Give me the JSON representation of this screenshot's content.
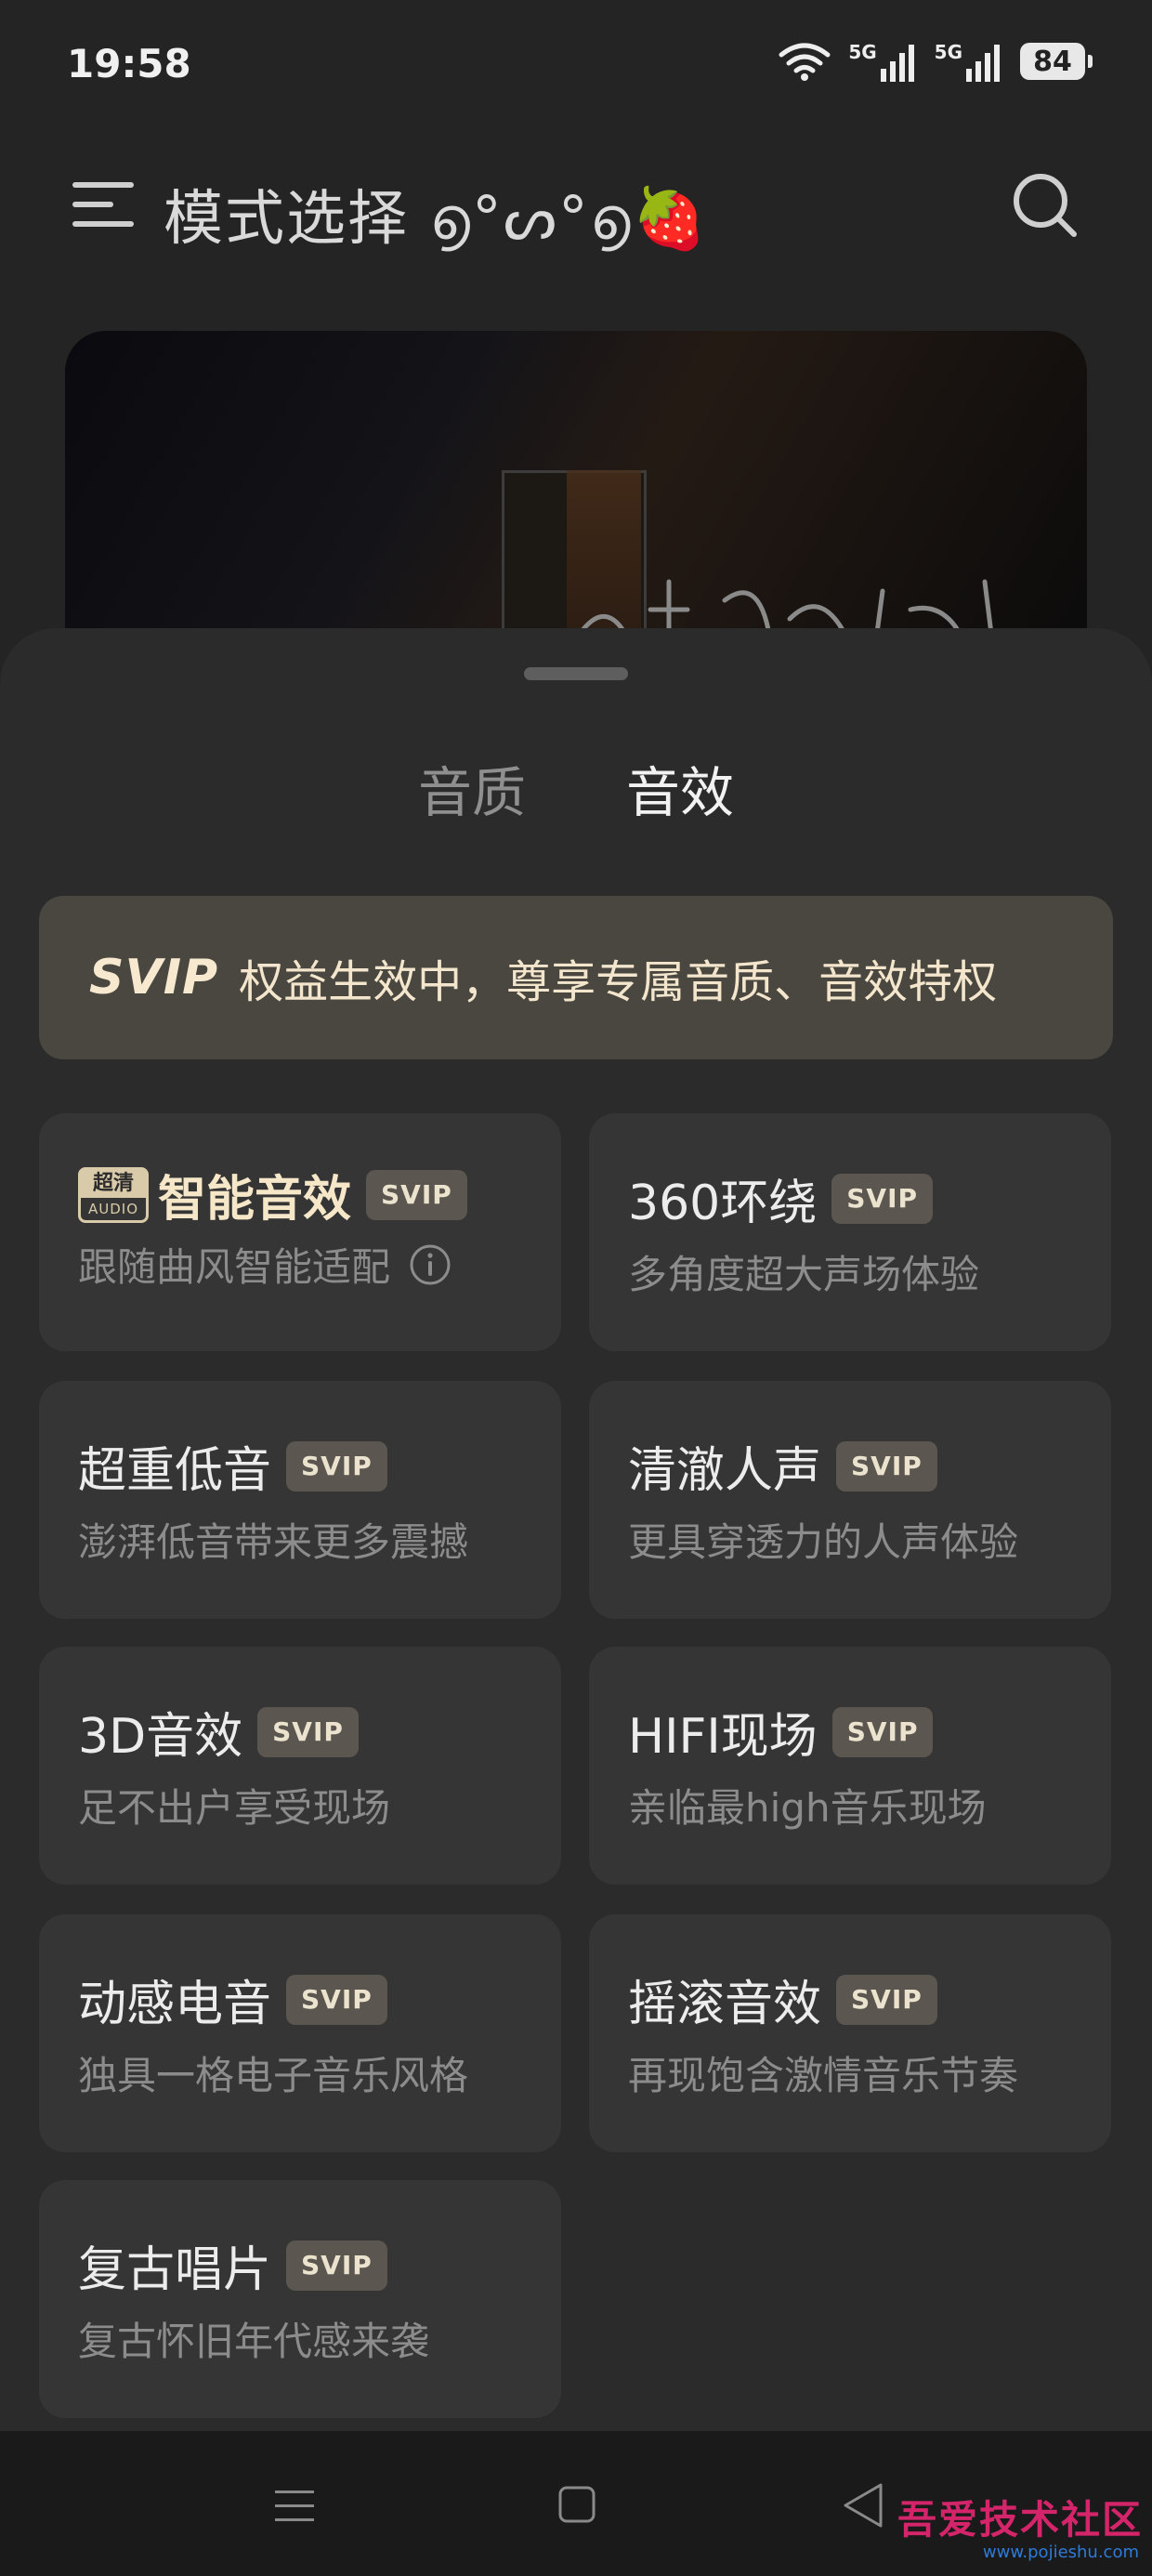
{
  "status_bar": {
    "time": "19:58",
    "battery": "84",
    "network_1": "5G",
    "network_2": "5G"
  },
  "header": {
    "title": "模式选择 ൭°ᔕ°൭🍓"
  },
  "sheet": {
    "tabs": [
      {
        "label": "音质",
        "active": false
      },
      {
        "label": "音效",
        "active": true
      }
    ],
    "svip_banner": {
      "logo": "SVIP",
      "text": "权益生效中，尊享专属音质、音效特权"
    },
    "audio_icon": {
      "top": "超清",
      "bottom": "AUDIO"
    },
    "effects": [
      {
        "title": "智能音效",
        "badge": "SVIP",
        "desc": "跟随曲风智能适配"
      },
      {
        "title": "360环绕",
        "badge": "SVIP",
        "desc": "多角度超大声场体验"
      },
      {
        "title": "超重低音",
        "badge": "SVIP",
        "desc": "澎湃低音带来更多震撼"
      },
      {
        "title": "清澈人声",
        "badge": "SVIP",
        "desc": "更具穿透力的人声体验"
      },
      {
        "title": "3D音效",
        "badge": "SVIP",
        "desc": "足不出户享受现场"
      },
      {
        "title": "HIFI现场",
        "badge": "SVIP",
        "desc": "亲临最high音乐现场"
      },
      {
        "title": "动感电音",
        "badge": "SVIP",
        "desc": "独具一格电子音乐风格"
      },
      {
        "title": "摇滚音效",
        "badge": "SVIP",
        "desc": "再现饱含激情音乐节奏"
      },
      {
        "title": "复古唱片",
        "badge": "SVIP",
        "desc": "复古怀旧年代感来袭"
      }
    ]
  },
  "watermark": {
    "text": "吾爱技术社区",
    "url": "www.pojieshu.com"
  },
  "colors": {
    "accent": "#2fcf6b",
    "sheet_bg": "#2b2b2b",
    "card_bg": "#353535",
    "svip_strip": "#4a4640"
  }
}
